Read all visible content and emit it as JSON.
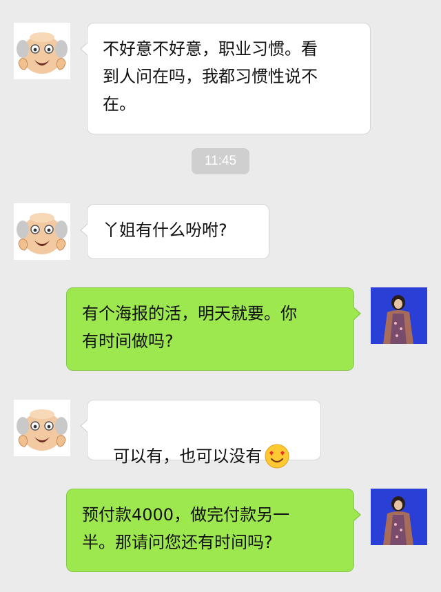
{
  "messages": [
    {
      "side": "left",
      "text": "不好意不好意，职业习惯。看\n到人问在吗，我都习惯性说不\n在。"
    },
    {
      "side": "left",
      "text": "丫姐有什么吩咐?"
    },
    {
      "side": "right",
      "text": "有个海报的活，明天就要。你\n有时间做吗?"
    },
    {
      "side": "left",
      "text": "可以有，也可以没有"
    },
    {
      "side": "right",
      "text": "预付款4000，做完付款另一\n半。那请问您还有时间吗?"
    }
  ],
  "timestamp": "11:45",
  "icons": {
    "contact_avatar": "old-man-emoji-icon",
    "self_avatar": "photo-avatar-icon",
    "inline_emoji": "smiling-face-heart-eyes-icon"
  },
  "colors": {
    "background": "#ebebeb",
    "incoming_bubble": "#ffffff",
    "outgoing_bubble": "#9de84f",
    "timestamp_bg": "#cfcfcf"
  }
}
